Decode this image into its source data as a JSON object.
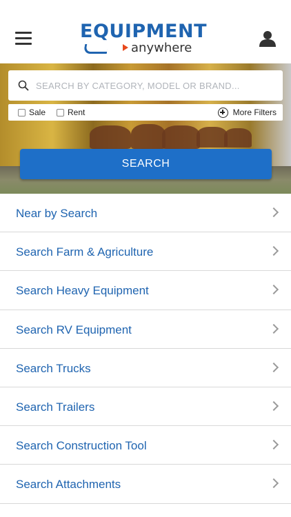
{
  "header": {
    "logo_main": "EQUIPMENT",
    "logo_sub": "anywhere",
    "menu_icon": "hamburger-menu-icon",
    "user_icon": "user-profile-icon"
  },
  "search": {
    "placeholder": "SEARCH BY CATEGORY, MODEL OR BRAND...",
    "button_label": "SEARCH"
  },
  "filters": {
    "sale_label": "Sale",
    "sale_checked": false,
    "rent_label": "Rent",
    "rent_checked": false,
    "more_label": "More Filters"
  },
  "menu_items": [
    {
      "label": "Near by Search"
    },
    {
      "label": "Search Farm & Agriculture"
    },
    {
      "label": "Search Heavy Equipment"
    },
    {
      "label": "Search RV Equipment"
    },
    {
      "label": "Search Trucks"
    },
    {
      "label": "Search Trailers"
    },
    {
      "label": "Search Construction Tool"
    },
    {
      "label": "Search Attachments"
    }
  ],
  "colors": {
    "brand_blue": "#1f64b0",
    "button_blue": "#1e6fc8",
    "accent_orange": "#e8491d"
  }
}
